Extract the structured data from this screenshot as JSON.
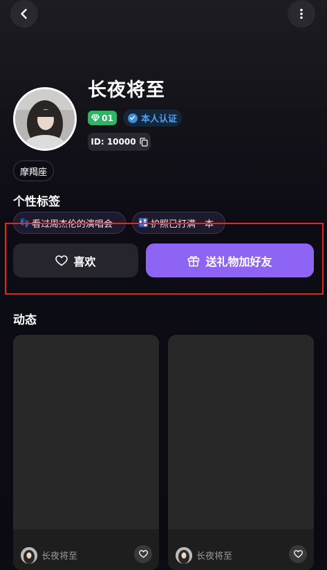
{
  "profile": {
    "name": "长夜将至",
    "level": "01",
    "verified_label": "本人认证",
    "id_text": "ID: 10000",
    "zodiac": "摩羯座"
  },
  "tags_section": {
    "title": "个性标签",
    "tags": [
      {
        "emoji": "👣",
        "label": "看过周杰伦的演唱会"
      },
      {
        "emoji": "🛂",
        "label": "护照已打满一本"
      }
    ]
  },
  "actions": {
    "like_label": "喜欢",
    "gift_label": "送礼物加好友"
  },
  "moments": {
    "title": "动态",
    "posts": [
      {
        "author": "长夜将至"
      },
      {
        "author": "长夜将至"
      }
    ]
  },
  "icons": {
    "back": "chevron-left-icon",
    "more": "more-vertical-icon",
    "level": "diamond-icon",
    "verify": "check-badge-icon",
    "copy": "copy-icon",
    "like": "heart-icon",
    "gift": "gift-icon"
  },
  "colors": {
    "background": "#0d0c14",
    "accent_purple": "#8e64f5",
    "level_green": "#2fb364",
    "verify_blue": "#4aa3f5",
    "highlight_red": "#e2291f"
  }
}
